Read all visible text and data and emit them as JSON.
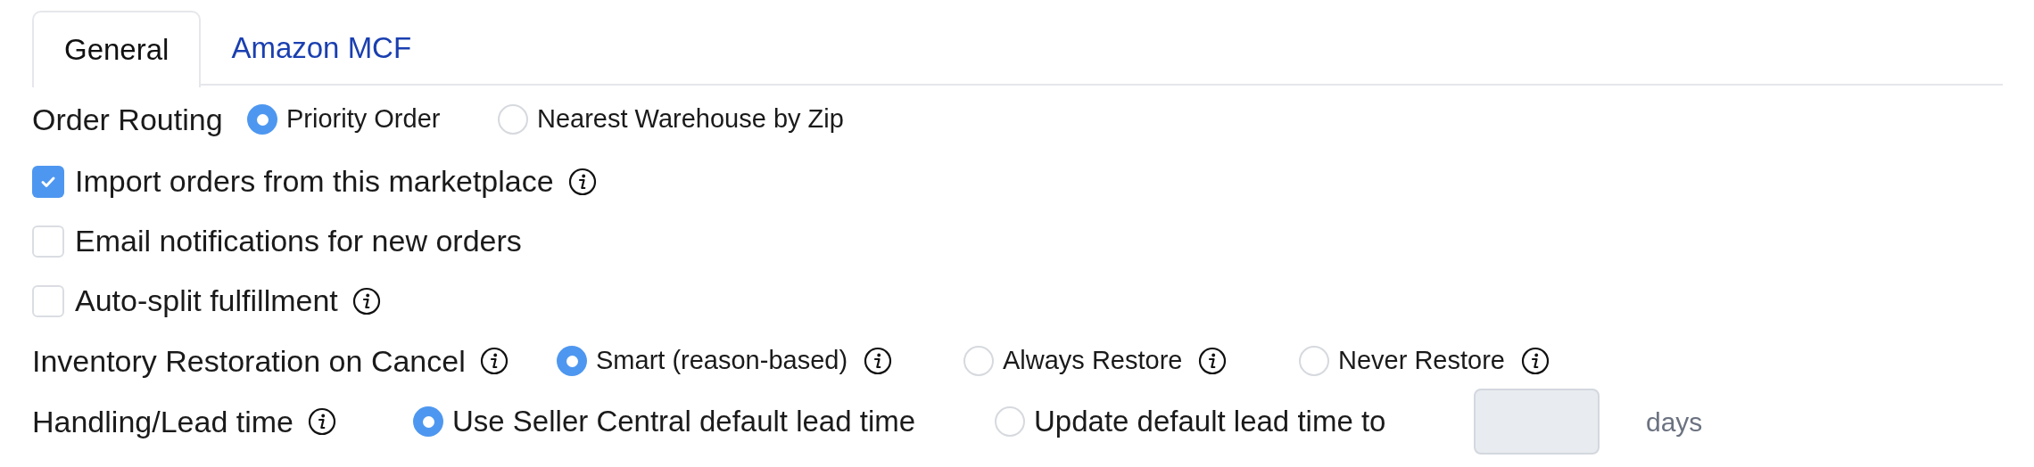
{
  "tabs": [
    {
      "label": "General",
      "selected": true
    },
    {
      "label": "Amazon MCF",
      "selected": false
    }
  ],
  "order_routing": {
    "label": "Order Routing",
    "options": [
      {
        "label": "Priority Order",
        "selected": true
      },
      {
        "label": "Nearest Warehouse by Zip",
        "selected": false
      }
    ]
  },
  "checkboxes": [
    {
      "label": "Import orders from this marketplace",
      "checked": true,
      "info": true
    },
    {
      "label": "Email notifications for new orders",
      "checked": false,
      "info": false
    },
    {
      "label": "Auto-split fulfillment",
      "checked": false,
      "info": true
    }
  ],
  "inventory_restoration": {
    "label": "Inventory Restoration on Cancel",
    "options": [
      {
        "label": "Smart (reason-based)",
        "selected": true
      },
      {
        "label": "Always Restore",
        "selected": false
      },
      {
        "label": "Never Restore",
        "selected": false
      }
    ]
  },
  "lead_time": {
    "label": "Handling/Lead time",
    "options": [
      {
        "label": "Use Seller Central default lead time",
        "selected": true
      },
      {
        "label": "Update default lead time to",
        "selected": false
      }
    ],
    "unit": "days"
  }
}
